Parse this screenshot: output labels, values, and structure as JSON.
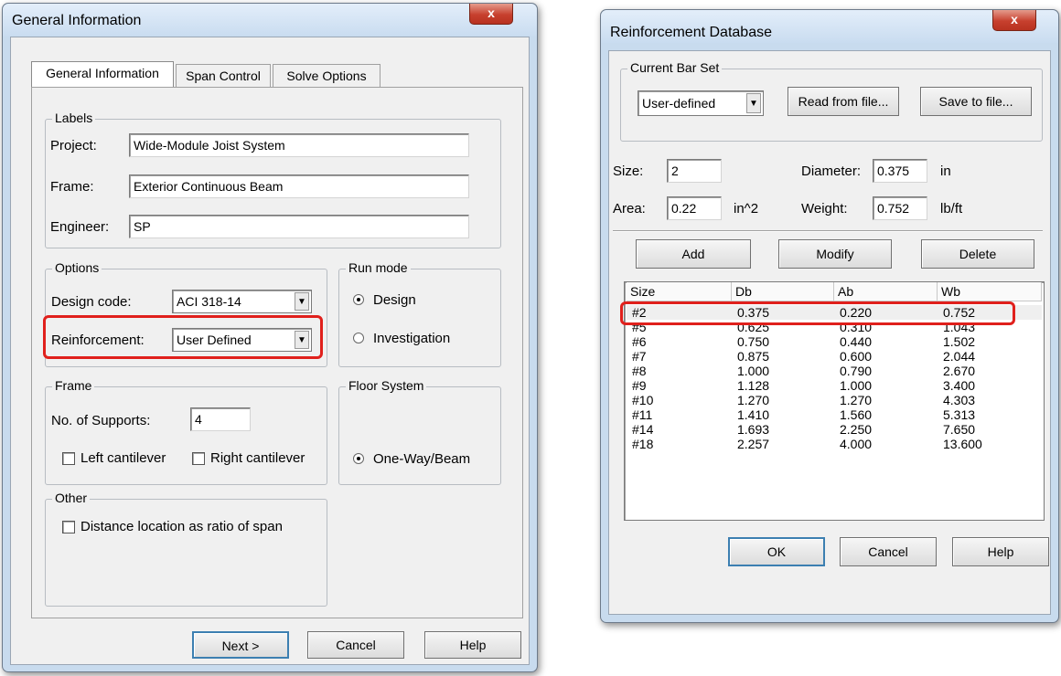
{
  "general_window": {
    "title": "General Information",
    "close_label": "x",
    "tabs": [
      "General Information",
      "Span Control",
      "Solve Options"
    ],
    "labels_group": {
      "title": "Labels",
      "project_label": "Project:",
      "project_value": "Wide-Module Joist System",
      "frame_label": "Frame:",
      "frame_value": "Exterior Continuous Beam",
      "engineer_label": "Engineer:",
      "engineer_value": "SP"
    },
    "options_group": {
      "title": "Options",
      "design_code_label": "Design code:",
      "design_code_value": "ACI 318-14",
      "reinforcement_label": "Reinforcement:",
      "reinforcement_value": "User Defined"
    },
    "run_mode_group": {
      "title": "Run mode",
      "design_label": "Design",
      "investigation_label": "Investigation"
    },
    "frame_group": {
      "title": "Frame",
      "supports_label": "No. of Supports:",
      "supports_value": "4",
      "left_cantilever_label": "Left cantilever",
      "right_cantilever_label": "Right cantilever"
    },
    "floor_group": {
      "title": "Floor System",
      "one_way_label": "One-Way/Beam"
    },
    "other_group": {
      "title": "Other",
      "distance_label": "Distance location as ratio of span"
    },
    "buttons": {
      "next": "Next >",
      "cancel": "Cancel",
      "help": "Help"
    }
  },
  "reinf_window": {
    "title": "Reinforcement Database",
    "close_label": "x",
    "bar_set": {
      "title": "Current Bar Set",
      "value": "User-defined",
      "read_label": "Read from file...",
      "save_label": "Save to file..."
    },
    "props": {
      "size_label": "Size:",
      "size_value": "2",
      "diameter_label": "Diameter:",
      "diameter_value": "0.375",
      "diameter_unit": "in",
      "area_label": "Area:",
      "area_value": "0.22",
      "area_unit": "in^2",
      "weight_label": "Weight:",
      "weight_value": "0.752",
      "weight_unit": "lb/ft"
    },
    "actions": {
      "add": "Add",
      "modify": "Modify",
      "delete": "Delete"
    },
    "table": {
      "headers": [
        "Size",
        "Db",
        "Ab",
        "Wb"
      ],
      "rows": [
        [
          "#2",
          "0.375",
          "0.220",
          "0.752"
        ],
        [
          "#5",
          "0.625",
          "0.310",
          "1.043"
        ],
        [
          "#6",
          "0.750",
          "0.440",
          "1.502"
        ],
        [
          "#7",
          "0.875",
          "0.600",
          "2.044"
        ],
        [
          "#8",
          "1.000",
          "0.790",
          "2.670"
        ],
        [
          "#9",
          "1.128",
          "1.000",
          "3.400"
        ],
        [
          "#10",
          "1.270",
          "1.270",
          "4.303"
        ],
        [
          "#11",
          "1.410",
          "1.560",
          "5.313"
        ],
        [
          "#14",
          "1.693",
          "2.250",
          "7.650"
        ],
        [
          "#18",
          "2.257",
          "4.000",
          "13.600"
        ]
      ]
    },
    "buttons": {
      "ok": "OK",
      "cancel": "Cancel",
      "help": "Help"
    }
  },
  "colors": {
    "highlight": "#e0201c",
    "frame": "#c8dbee",
    "close_button": "#c7402e"
  }
}
